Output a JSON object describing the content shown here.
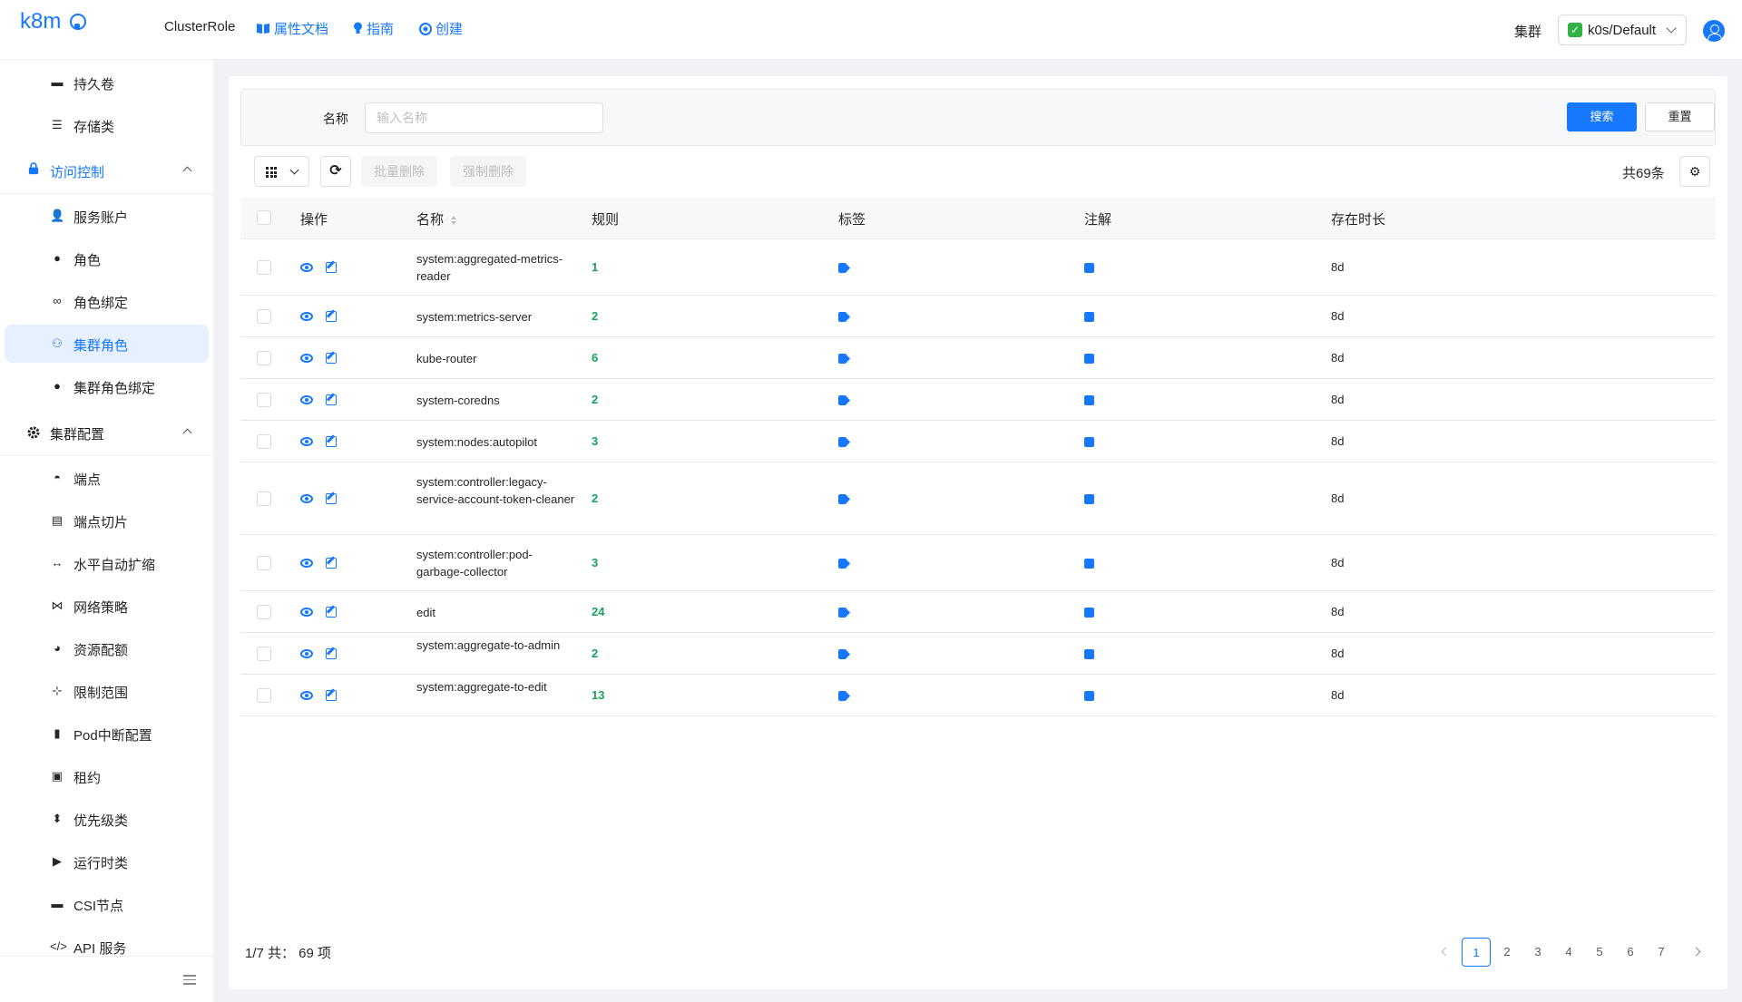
{
  "header": {
    "logo_text": "k8m",
    "kind": "ClusterRole",
    "links": [
      {
        "icon": "book-icon",
        "label": "属性文档"
      },
      {
        "icon": "bulb-icon",
        "label": "指南"
      },
      {
        "icon": "create-icon",
        "label": "创建"
      }
    ],
    "cluster_label": "集群",
    "cluster_value": "k0s/Default"
  },
  "sidebar": {
    "top_items": [
      {
        "icon": "volume-icon",
        "label": "持久卷"
      },
      {
        "icon": "storage-class-icon",
        "label": "存储类"
      }
    ],
    "groups": [
      {
        "icon": "lock-icon",
        "label": "访问控制",
        "items": [
          {
            "icon": "service-account-icon",
            "label": "服务账户"
          },
          {
            "icon": "role-icon",
            "label": "角色"
          },
          {
            "icon": "link-icon",
            "label": "角色绑定"
          },
          {
            "icon": "cluster-role-icon",
            "label": "集群角色",
            "active": true
          },
          {
            "icon": "cluster-role-binding-icon",
            "label": "集群角色绑定"
          }
        ]
      },
      {
        "icon": "gear-icon",
        "label": "集群配置",
        "items": [
          {
            "icon": "endpoint-icon",
            "label": "端点"
          },
          {
            "icon": "endpoint-slice-icon",
            "label": "端点切片"
          },
          {
            "icon": "hpa-icon",
            "label": "水平自动扩缩"
          },
          {
            "icon": "network-policy-icon",
            "label": "网络策略"
          },
          {
            "icon": "resource-quota-icon",
            "label": "资源配额"
          },
          {
            "icon": "limit-range-icon",
            "label": "限制范围"
          },
          {
            "icon": "pdb-icon",
            "label": "Pod中断配置"
          },
          {
            "icon": "lease-icon",
            "label": "租约"
          },
          {
            "icon": "priority-class-icon",
            "label": "优先级类"
          },
          {
            "icon": "runtime-class-icon",
            "label": "运行时类"
          },
          {
            "icon": "csi-node-icon",
            "label": "CSI节点"
          },
          {
            "icon": "api-service-icon",
            "label": "API 服务"
          }
        ]
      }
    ]
  },
  "search": {
    "label": "名称",
    "placeholder": "输入名称",
    "value": "",
    "search_button": "搜索",
    "reset_button": "重置"
  },
  "toolbar": {
    "batch_delete": "批量删除",
    "force_delete": "强制删除",
    "total": "共69条"
  },
  "table": {
    "columns": [
      "操作",
      "名称",
      "规则",
      "标签",
      "注解",
      "存在时长"
    ],
    "rows": [
      {
        "name": "system:aggregated-metrics-reader",
        "rules": "1",
        "age": "8d"
      },
      {
        "name": "system:metrics-server",
        "rules": "2",
        "age": "8d"
      },
      {
        "name": "kube-router",
        "rules": "6",
        "age": "8d"
      },
      {
        "name": "system-coredns",
        "rules": "2",
        "age": "8d"
      },
      {
        "name": "system:nodes:autopilot",
        "rules": "3",
        "age": "8d"
      },
      {
        "name": "system:controller:legacy-service-account-token-cleaner",
        "rules": "2",
        "age": "8d"
      },
      {
        "name": "system:controller:pod-garbage-collector",
        "rules": "3",
        "age": "8d"
      },
      {
        "name": "edit",
        "rules": "24",
        "age": "8d"
      },
      {
        "name": "system:aggregate-to-admin",
        "rules": "2",
        "age": "8d"
      },
      {
        "name": "system:aggregate-to-edit",
        "rules": "13",
        "age": "8d"
      }
    ]
  },
  "footer": {
    "info": "1/7 共： 69 项",
    "pages": [
      "1",
      "2",
      "3",
      "4",
      "5",
      "6",
      "7"
    ],
    "current_page": "1"
  },
  "colors": {
    "accent": "#1677ff",
    "rules_green": "#18a058"
  }
}
